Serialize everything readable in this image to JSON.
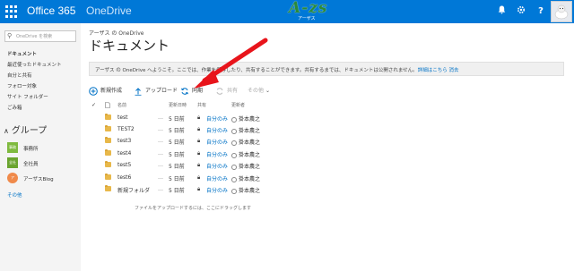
{
  "topbar": {
    "brand": "Office 365",
    "app": "OneDrive",
    "logo_text": "A-zs",
    "logo_sub": "アーザス",
    "icons": [
      "bell-icon",
      "gear-icon",
      "help-icon"
    ],
    "help_glyph": "?",
    "accent": "#0078d7"
  },
  "sidebar": {
    "search_placeholder": "OneDrive を検索",
    "items": [
      {
        "label": "ドキュメント",
        "active": true
      },
      {
        "label": "最近使ったドキュメント"
      },
      {
        "label": "自分と共有"
      },
      {
        "label": "フォロー対象"
      },
      {
        "label": "サイト フォルダー"
      },
      {
        "label": "ごみ箱"
      }
    ],
    "groups_heading": "グループ",
    "groups": [
      {
        "badge": "事務",
        "label": "事務所",
        "color": "#7fba3f"
      },
      {
        "badge": "全社",
        "label": "全社員",
        "color": "#6aa42f"
      },
      {
        "badge": "ア",
        "label": "アーザスBlog",
        "color": "#f08a4b"
      }
    ],
    "other_link": "その他"
  },
  "main": {
    "breadcrumb": "アーザス の OneDrive",
    "title": "ドキュメント",
    "notice_text": "アーザス の OneDrive へようこそ。ここでは、作業を保存したり、共有することができます。共有するまでは、ドキュメントは公開されません。",
    "notice_link": "詳細はこちら",
    "notice_dismiss": "消去",
    "commands": [
      {
        "label": "新規作成",
        "icon": "plus-circle-icon"
      },
      {
        "label": "アップロード",
        "icon": "upload-icon"
      },
      {
        "label": "同期",
        "icon": "sync-icon"
      },
      {
        "label": "共有",
        "icon": "share-icon",
        "disabled": true
      },
      {
        "label": "その他",
        "icon": "chevron-down-icon",
        "disabled": true
      }
    ],
    "columns": {
      "name": "名前",
      "modified": "更新日時",
      "sharing": "共有",
      "modified_by": "更新者"
    },
    "rows": [
      {
        "name": "test",
        "modified": "5 日前",
        "sharing": "自分のみ",
        "modified_by": "掛本農之"
      },
      {
        "name": "TEST2",
        "modified": "5 日前",
        "sharing": "自分のみ",
        "modified_by": "掛本農之"
      },
      {
        "name": "test3",
        "modified": "5 日前",
        "sharing": "自分のみ",
        "modified_by": "掛本農之"
      },
      {
        "name": "test4",
        "modified": "5 日前",
        "sharing": "自分のみ",
        "modified_by": "掛本農之"
      },
      {
        "name": "test5",
        "modified": "5 日前",
        "sharing": "自分のみ",
        "modified_by": "掛本農之"
      },
      {
        "name": "test6",
        "modified": "5 日前",
        "sharing": "自分のみ",
        "modified_by": "掛本農之"
      },
      {
        "name": "新規フォルダ",
        "modified": "5 日前",
        "sharing": "自分のみ",
        "modified_by": "掛本農之"
      }
    ],
    "drop_hint": "ファイルをアップロードするには、ここにドラッグします"
  }
}
